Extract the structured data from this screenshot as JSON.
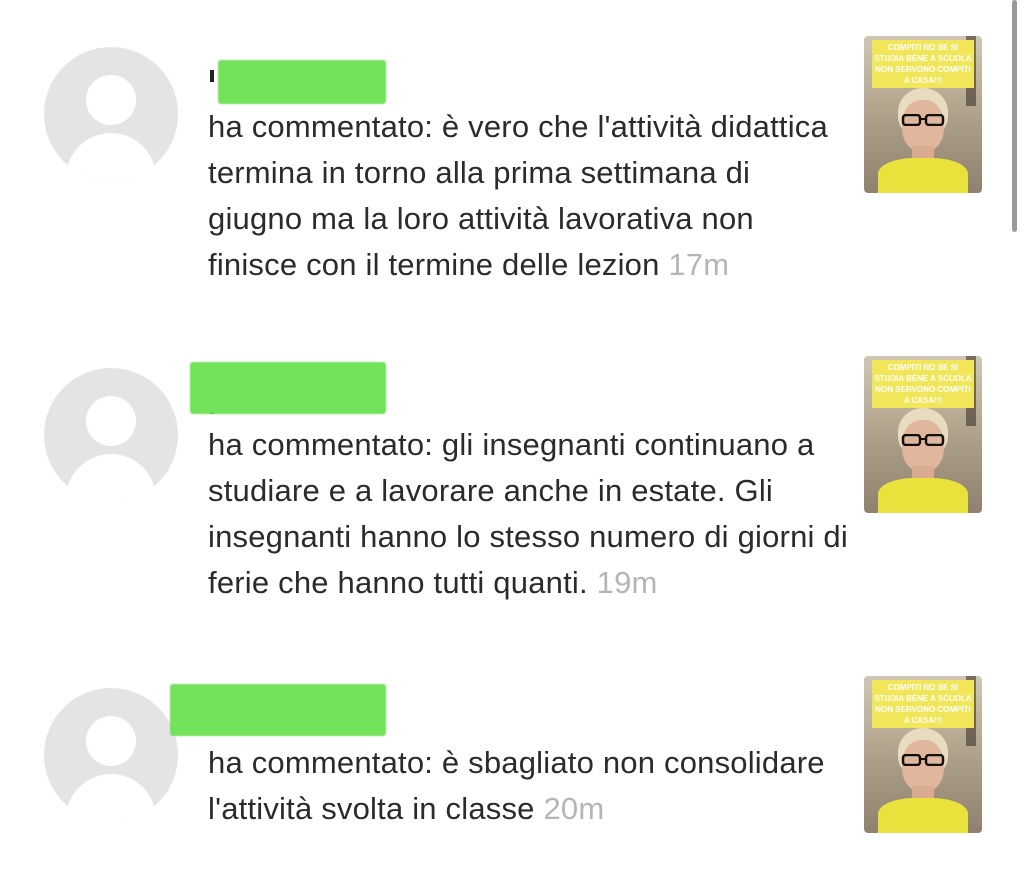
{
  "notifications": [
    {
      "comment": "ha commentato: è vero che l'attività didattica termina in torno alla prima settimana di giugno ma la loro attività lavorativa non finisce con il termine delle lezion",
      "time": "17m",
      "thumbnail_caption": "COMPITI NO SE SI STUDIA BENE A SCUOLA NON SERVONO COMPITI A CASA!!!"
    },
    {
      "comment": "ha commentato: gli insegnanti continuano a studiare e a lavorare anche in estate. Gli insegnanti hanno lo stesso numero di giorni di ferie che hanno tutti quanti.",
      "time": "19m",
      "thumbnail_caption": "COMPITI NO SE SI STUDIA BENE A SCUOLA NON SERVONO COMPITI A CASA!!!"
    },
    {
      "comment": "ha commentato: è sbagliato non consolidare l'attività svolta in classe",
      "time": "20m",
      "thumbnail_caption": "COMPITI NO SE SI STUDIA BENE A SCUOLA NON SERVONO COMPITI A CASA!!!"
    }
  ],
  "icons": {
    "avatar": "default-user-avatar-icon",
    "thumbnail": "video-thumbnail"
  },
  "colors": {
    "redaction": "#72e35a",
    "timestamp": "#b5b5b5",
    "avatar_bg": "#e4e4e4",
    "caption_bg": "#f1e65a"
  }
}
